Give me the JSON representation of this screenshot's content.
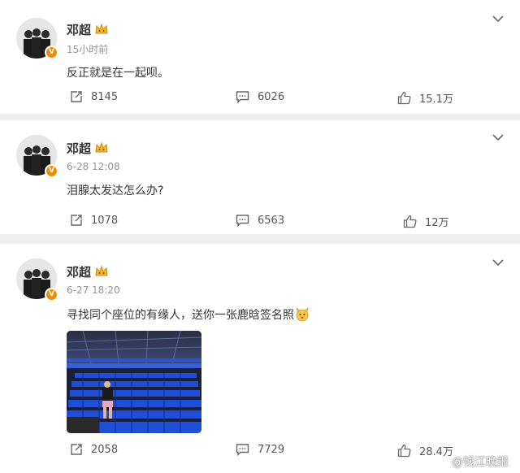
{
  "posts": [
    {
      "user": "邓超",
      "time": "15小时前",
      "text": "反正就是在一起呗。",
      "repost": "8145",
      "comment": "6026",
      "like": "15.1万"
    },
    {
      "user": "邓超",
      "time": "6-28 12:08",
      "text": "泪腺太发达怎么办?",
      "repost": "1078",
      "comment": "6563",
      "like": "12万"
    },
    {
      "user": "邓超",
      "time": "6-27 18:20",
      "text": "寻找同个座位的有缘人，送你一张鹿晗签名照",
      "repost": "2058",
      "comment": "7729",
      "like": "28.4万"
    }
  ],
  "badge_letter": "V",
  "watermark": "@钱江晚报",
  "colors": {
    "verified": "#f08c00",
    "seat_blue": "#1f4fd6",
    "name": "#333333",
    "meta": "#939393"
  },
  "icons": [
    "repost-icon",
    "comment-icon",
    "like-icon",
    "chevron-down-icon",
    "crown-icon",
    "verified-badge-icon",
    "emoji-icon",
    "weibo-logo-icon"
  ]
}
